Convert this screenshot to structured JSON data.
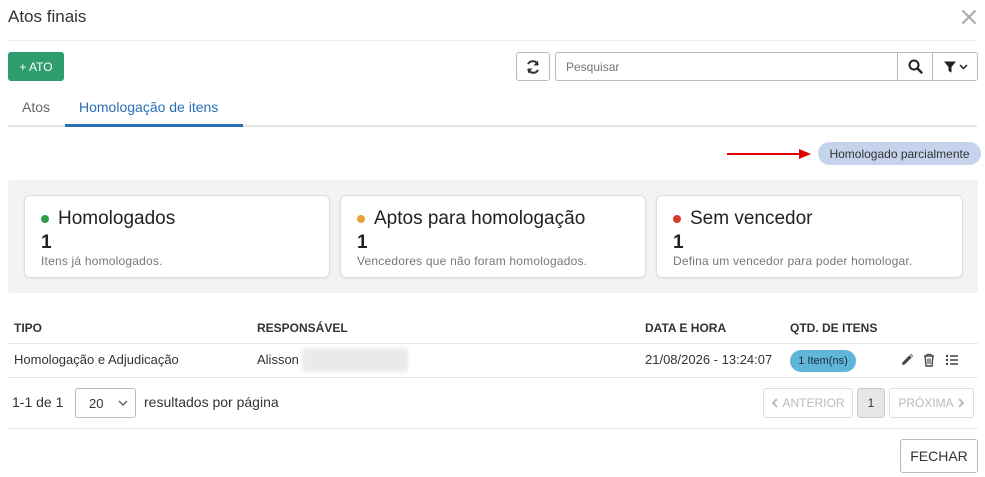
{
  "dialog": {
    "title": "Atos finais"
  },
  "toolbar": {
    "add_label": "+ ATO",
    "search_placeholder": "Pesquisar"
  },
  "tabs": [
    {
      "label": "Atos",
      "active": false
    },
    {
      "label": "Homologação de itens",
      "active": true
    }
  ],
  "status_badge": {
    "label": "Homologado parcialmente",
    "color": "#c5d4ec"
  },
  "cards": [
    {
      "title": "Homologados",
      "count": "1",
      "description": "Itens já homologados.",
      "dot_color": "#2e9e4e"
    },
    {
      "title": "Aptos para homologação",
      "count": "1",
      "description": "Vencedores que não foram homologados.",
      "dot_color": "#e8a33d"
    },
    {
      "title": "Sem vencedor",
      "count": "1",
      "description": "Defina um vencedor para poder homologar.",
      "dot_color": "#d93a2b"
    }
  ],
  "table": {
    "columns": [
      "TIPO",
      "RESPONSÁVEL",
      "DATA E HORA",
      "QTD. DE ITENS"
    ],
    "rows": [
      {
        "tipo": "Homologação e Adjudicação",
        "responsavel": "Alisson",
        "data_hora": "21/08/2026 - 13:24:07",
        "qtd_itens": "1 Item(ns)"
      }
    ]
  },
  "pagination": {
    "range": "1-1 de 1",
    "per_page": "20",
    "per_page_label": "resultados por página",
    "prev_label": "ANTERIOR",
    "current_page": "1",
    "next_label": "PRÓXIMA"
  },
  "footer": {
    "close_label": "FECHAR"
  },
  "colors": {
    "primary": "#2e9e6e",
    "tab_active": "#2a6fb5",
    "qty_pill": "#5fb6d9",
    "arrow": "#e00000"
  }
}
